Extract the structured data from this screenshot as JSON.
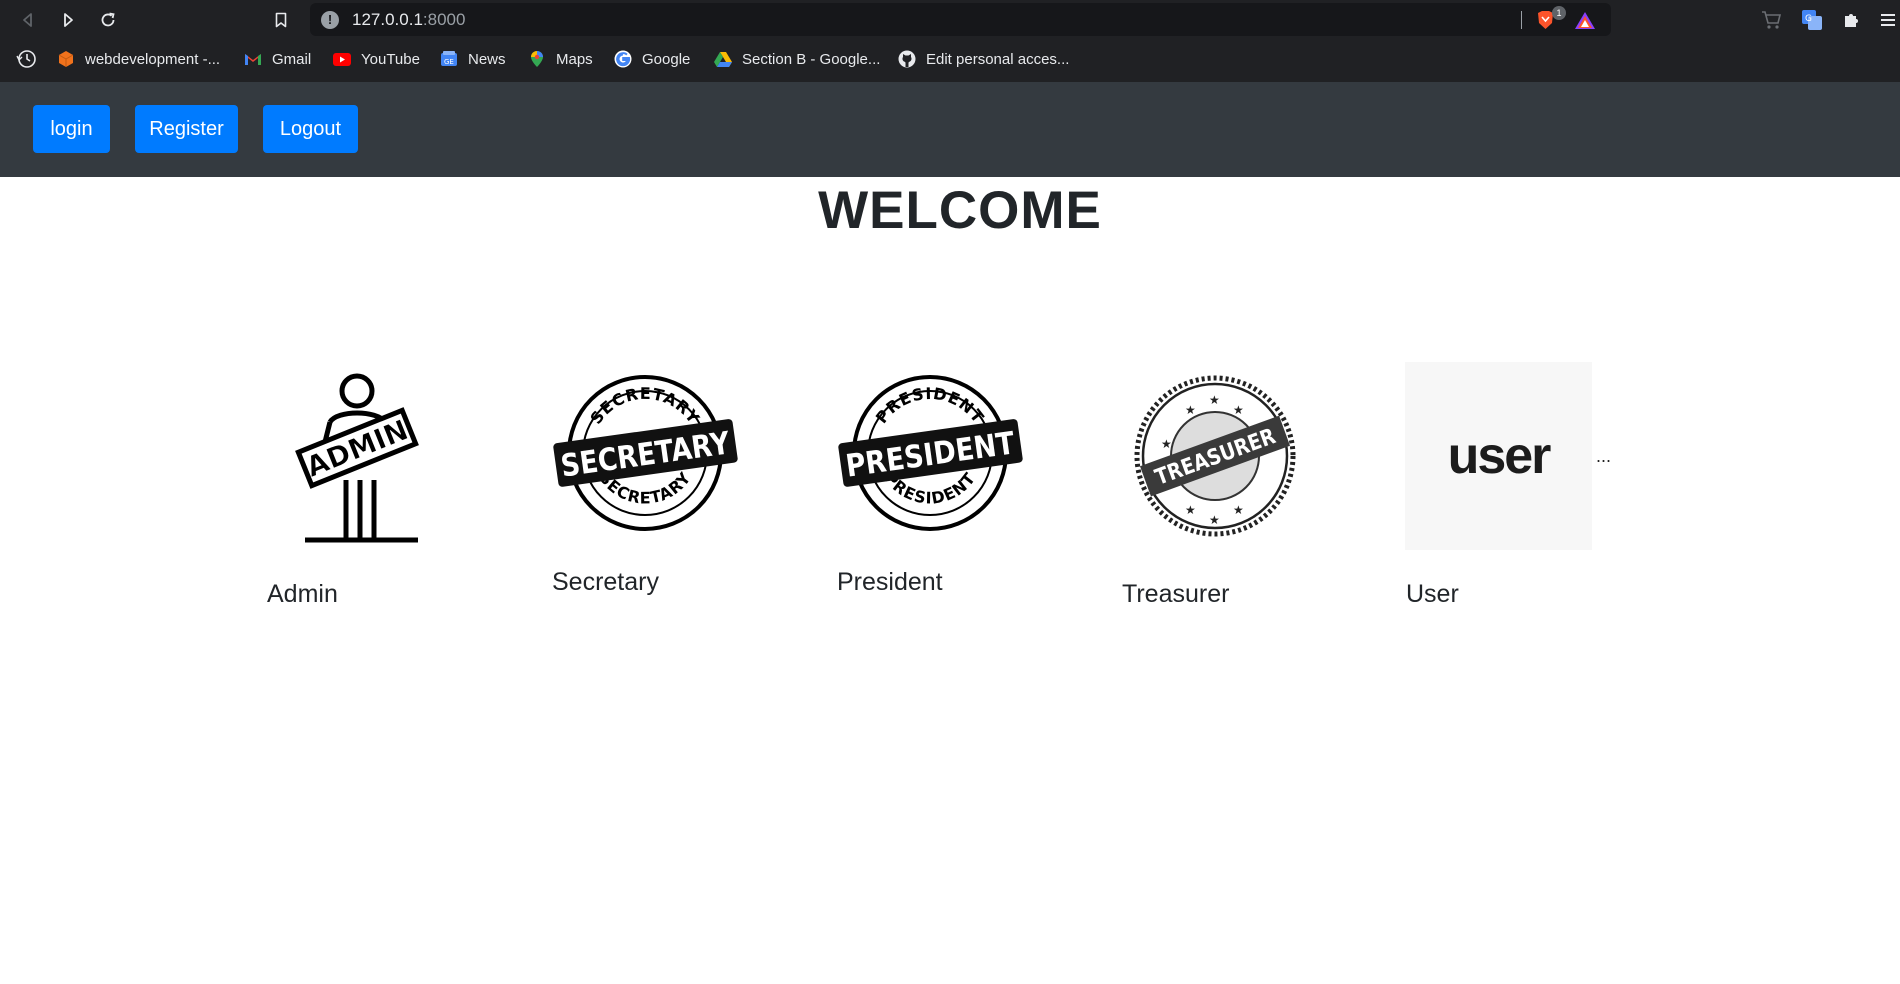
{
  "browser": {
    "url_host": "127.0.0.1",
    "url_port": ":8000",
    "brave_badge_count": "1",
    "bookmarks": [
      {
        "label": "webdevelopment -...",
        "icon": "cube-icon"
      },
      {
        "label": "Gmail",
        "icon": "gmail-icon"
      },
      {
        "label": "YouTube",
        "icon": "youtube-icon"
      },
      {
        "label": "News",
        "icon": "news-icon"
      },
      {
        "label": "Maps",
        "icon": "maps-icon"
      },
      {
        "label": "Google",
        "icon": "google-icon"
      },
      {
        "label": "Section B - Google...",
        "icon": "drive-icon"
      },
      {
        "label": "Edit personal acces...",
        "icon": "github-icon"
      }
    ]
  },
  "navbar": {
    "login_label": "login",
    "register_label": "Register",
    "logout_label": "Logout",
    "button_color": "#007bff",
    "background_color": "#343a40"
  },
  "main": {
    "title": "WELCOME",
    "roles": [
      {
        "label": "Admin",
        "stamp_text": "ADMIN"
      },
      {
        "label": "Secretary",
        "stamp_text": "SECRETARY",
        "ring_text": "SECRETARY"
      },
      {
        "label": "President",
        "stamp_text": "PRESIDENT",
        "ring_text": "PRESIDENT"
      },
      {
        "label": "Treasurer",
        "stamp_text": "TREASURER"
      },
      {
        "label": "User",
        "stamp_text": "user"
      }
    ],
    "overflow_text": "..."
  }
}
